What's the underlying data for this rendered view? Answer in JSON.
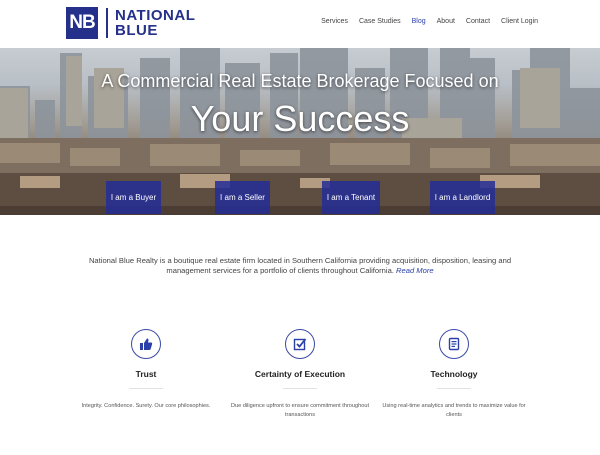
{
  "brand": {
    "mark": "NB",
    "line1": "NATIONAL",
    "line2": "BLUE"
  },
  "nav": [
    {
      "label": "Services"
    },
    {
      "label": "Case Studies"
    },
    {
      "label": "Blog",
      "active": true
    },
    {
      "label": "About"
    },
    {
      "label": "Contact"
    },
    {
      "label": "Client Login"
    }
  ],
  "hero": {
    "line1": "A Commercial Real Estate Brokerage Focused on",
    "line2": "Your Success",
    "buttons": [
      "I am a Buyer",
      "I am a Seller",
      "I am a Tenant",
      "I am a Landlord"
    ]
  },
  "intro": {
    "text": "National Blue Realty is a boutique real estate firm located in Southern California providing acquisition, disposition, leasing and management services for a portfolio of clients throughout California.",
    "link": "Read More"
  },
  "features": [
    {
      "icon": "thumbs-up-icon",
      "title": "Trust",
      "desc": "Integrity. Confidence. Surety. Our core philosophies."
    },
    {
      "icon": "checkbox-icon",
      "title": "Certainty of Execution",
      "desc": "Due diligence upfront to ensure commitment throughout transactions"
    },
    {
      "icon": "document-icon",
      "title": "Technology",
      "desc": "Using real-time analytics and trends to maximize value for clients"
    }
  ],
  "colors": {
    "brand": "#24308a",
    "accent": "#2a3fa8",
    "cta": "#232d96"
  }
}
